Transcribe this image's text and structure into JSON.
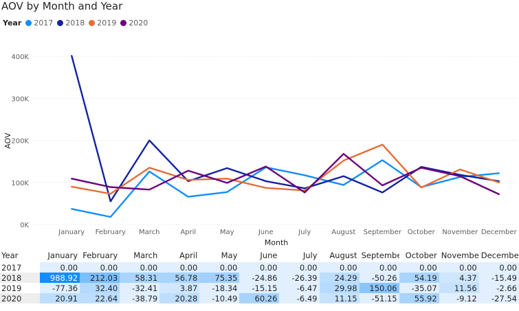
{
  "title": "AOV by Month and Year",
  "legend": {
    "title": "Year",
    "items": [
      {
        "label": "2017",
        "color": "#118DFF"
      },
      {
        "label": "2018",
        "color": "#12239E"
      },
      {
        "label": "2019",
        "color": "#E66C37"
      },
      {
        "label": "2020",
        "color": "#6B007B"
      }
    ]
  },
  "chart_data": {
    "type": "line",
    "title": "AOV by Month and Year",
    "xlabel": "Month",
    "ylabel": "AOV",
    "x": [
      "January",
      "February",
      "March",
      "April",
      "May",
      "June",
      "July",
      "August",
      "September",
      "October",
      "November",
      "December"
    ],
    "yticks": [
      "0K",
      "100K",
      "200K",
      "300K",
      "400K"
    ],
    "ylim": [
      0,
      400000
    ],
    "grid": true,
    "legend_position": "top-left",
    "series": [
      {
        "name": "2017",
        "color": "#118DFF",
        "values": [
          37000,
          18000,
          126000,
          66000,
          77000,
          136000,
          117000,
          94000,
          153000,
          89000,
          113000,
          122000
        ]
      },
      {
        "name": "2018",
        "color": "#12239E",
        "values": [
          401000,
          55000,
          200000,
          103000,
          134000,
          103000,
          86000,
          115000,
          76000,
          137000,
          118000,
          103000
        ]
      },
      {
        "name": "2019",
        "color": "#E66C37",
        "values": [
          90000,
          73000,
          135000,
          106000,
          109000,
          87000,
          81000,
          152000,
          190000,
          88000,
          131000,
          100000
        ]
      },
      {
        "name": "2020",
        "color": "#6B007B",
        "values": [
          109000,
          89000,
          83000,
          128000,
          99000,
          138000,
          76000,
          168000,
          93000,
          135000,
          115000,
          72000
        ]
      }
    ]
  },
  "matrix": {
    "corner": "Year",
    "columns": [
      "January",
      "February",
      "March",
      "April",
      "May",
      "June",
      "July",
      "August",
      "September",
      "October",
      "November",
      "December"
    ],
    "rows": [
      {
        "year": "2017",
        "cells": [
          "0.00",
          "0.00",
          "0.00",
          "0.00",
          "0.00",
          "0.00",
          "0.00",
          "0.00",
          "0.00",
          "0.00",
          "0.00",
          "0.00"
        ]
      },
      {
        "year": "2018",
        "cells": [
          "988.92",
          "212.03",
          "58.31",
          "56.78",
          "75.35",
          "-24.86",
          "-26.39",
          "24.29",
          "-50.26",
          "54.19",
          "4.37",
          "-15.49"
        ]
      },
      {
        "year": "2019",
        "cells": [
          "-77.36",
          "32.40",
          "-32.41",
          "3.87",
          "-18.34",
          "-15.15",
          "-6.47",
          "29.98",
          "150.06",
          "-35.07",
          "11.56",
          "-2.66"
        ]
      },
      {
        "year": "2020",
        "cells": [
          "20.91",
          "22.64",
          "-38.79",
          "20.28",
          "-10.49",
          "60.26",
          "-6.49",
          "11.15",
          "-51.15",
          "55.92",
          "-9.12",
          "-27.54"
        ]
      }
    ]
  }
}
